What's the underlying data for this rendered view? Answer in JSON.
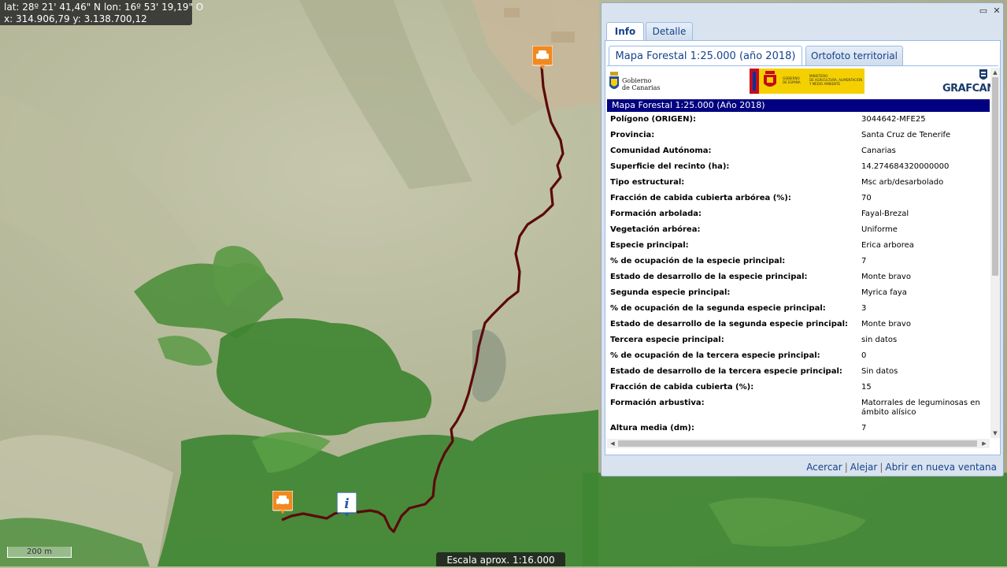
{
  "coordinates": {
    "latlon": "lat: 28º 21' 41,46\" N  lon: 16º 53' 19,19\" O",
    "xy": "x: 314.906,79  y: 3.138.700,12"
  },
  "map": {
    "scale_bar_label": "200 m",
    "scale_text": "Escala aprox. 1:16.000",
    "markers": [
      "parking-icon",
      "parking-icon",
      "info-icon"
    ],
    "route_color": "#5a0a0a"
  },
  "panel": {
    "tabs": [
      {
        "label": "Info",
        "active": true
      },
      {
        "label": "Detalle",
        "active": false
      }
    ],
    "subtabs": [
      {
        "label": "Mapa Forestal 1:25.000 (año 2018)",
        "active": true
      },
      {
        "label": "Ortofoto territorial",
        "active": false
      }
    ],
    "logos": {
      "gobierno_line1": "Gobierno",
      "gobierno_line2": "de Canarias",
      "ministry_line1": "GOBIERNO",
      "ministry_line2": "DE ESPAÑA",
      "ministry_line3": "MINISTERIO",
      "ministry_line4": "DE AGRICULTURA, ALIMENTACIÓN",
      "ministry_line5": "Y MEDIO AMBIENTE",
      "grafcan": "GRAFCAN"
    },
    "table_title": "Mapa Forestal 1:25.000 (Año 2018)",
    "rows": [
      {
        "label": "Polígono (ORIGEN):",
        "value": "3044642-MFE25"
      },
      {
        "label": "Provincia:",
        "value": "Santa Cruz de Tenerife"
      },
      {
        "label": "Comunidad Autónoma:",
        "value": "Canarias"
      },
      {
        "label": "Superficie del recinto (ha):",
        "value": "14.274684320000000"
      },
      {
        "label": "Tipo estructural:",
        "value": "Msc arb/desarbolado"
      },
      {
        "label": "Fracción de cabida cubierta arbórea (%):",
        "value": "70"
      },
      {
        "label": "Formación arbolada:",
        "value": "Fayal-Brezal"
      },
      {
        "label": "Vegetación arbórea:",
        "value": "Uniforme"
      },
      {
        "label": "Especie principal:",
        "value": "Erica arborea"
      },
      {
        "label": "% de ocupación de la especie principal:",
        "value": "7"
      },
      {
        "label": "Estado de desarrollo de la especie principal:",
        "value": "Monte bravo"
      },
      {
        "label": "Segunda especie principal:",
        "value": "Myrica faya"
      },
      {
        "label": "% de ocupación de la segunda especie principal:",
        "value": "3"
      },
      {
        "label": "Estado de desarrollo de la segunda especie principal:",
        "value": "Monte bravo"
      },
      {
        "label": "Tercera especie principal:",
        "value": "sin datos"
      },
      {
        "label": "% de ocupación de la tercera especie principal:",
        "value": "0"
      },
      {
        "label": "Estado de desarrollo de la tercera especie principal:",
        "value": "Sin datos"
      },
      {
        "label": "Fracción de cabida cubierta (%):",
        "value": "15"
      },
      {
        "label": "Formación arbustiva:",
        "value": "Matorrales de leguminosas en ámbito alísico"
      },
      {
        "label": "Altura media (dm):",
        "value": "7"
      }
    ],
    "footer": {
      "zoom_in": "Acercar",
      "zoom_out": "Alejar",
      "open_new": "Abrir en nueva ventana"
    }
  }
}
